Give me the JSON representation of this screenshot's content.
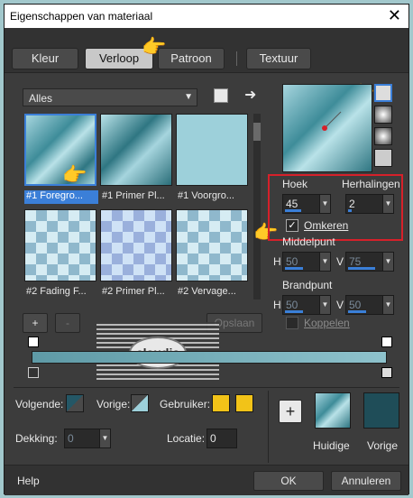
{
  "window": {
    "title": "Eigenschappen van materiaal",
    "close_glyph": "✕"
  },
  "tabs": [
    "Kleur",
    "Verloop",
    "Patroon",
    "Textuur"
  ],
  "filter": {
    "value": "Alles"
  },
  "gradients": [
    {
      "label": "#1 Foregro...",
      "selected": true
    },
    {
      "label": "#1 Primer Pl..."
    },
    {
      "label": "#1 Voorgro..."
    },
    {
      "label": "#2 Fading F..."
    },
    {
      "label": "#2 Primer Pl..."
    },
    {
      "label": "#2 Vervage..."
    }
  ],
  "controls": {
    "hoek_label": "Hoek",
    "hoek_value": "45",
    "herhalingen_label": "Herhalingen",
    "herhalingen_value": "2",
    "omkeren_label": "Omkeren",
    "omkeren_checked": true,
    "middelpunt_label": "Middelpunt",
    "h1_label": "H",
    "h1_value": "50",
    "v1_label": "V",
    "v1_value": "75",
    "brandpunt_label": "Brandpunt",
    "h2_label": "H",
    "h2_value": "50",
    "v2_label": "V",
    "v2_value": "50",
    "koppelen_label": "Koppelen"
  },
  "editor": {
    "add_btn": "+",
    "remove_btn": "-",
    "opslaan_label": "Opslaan",
    "watermark": "claudia"
  },
  "bottom": {
    "volgende_label": "Volgende:",
    "vorige_label": "Vorige:",
    "gebruiker_label": "Gebruiker:",
    "dekking_label": "Dekking:",
    "dekking_value": "0",
    "locatie_label": "Locatie:",
    "locatie_value": "0",
    "huidige_label": "Huidige",
    "vorige2_label": "Vorige",
    "plus": "+"
  },
  "footer": {
    "help": "Help",
    "ok": "OK",
    "cancel": "Annuleren"
  },
  "colors": {
    "accent": "#3b7fd8",
    "highlight": "#d6202a",
    "user_swatch": "#f2c318",
    "vorige_swatch": "#1f4d58"
  }
}
